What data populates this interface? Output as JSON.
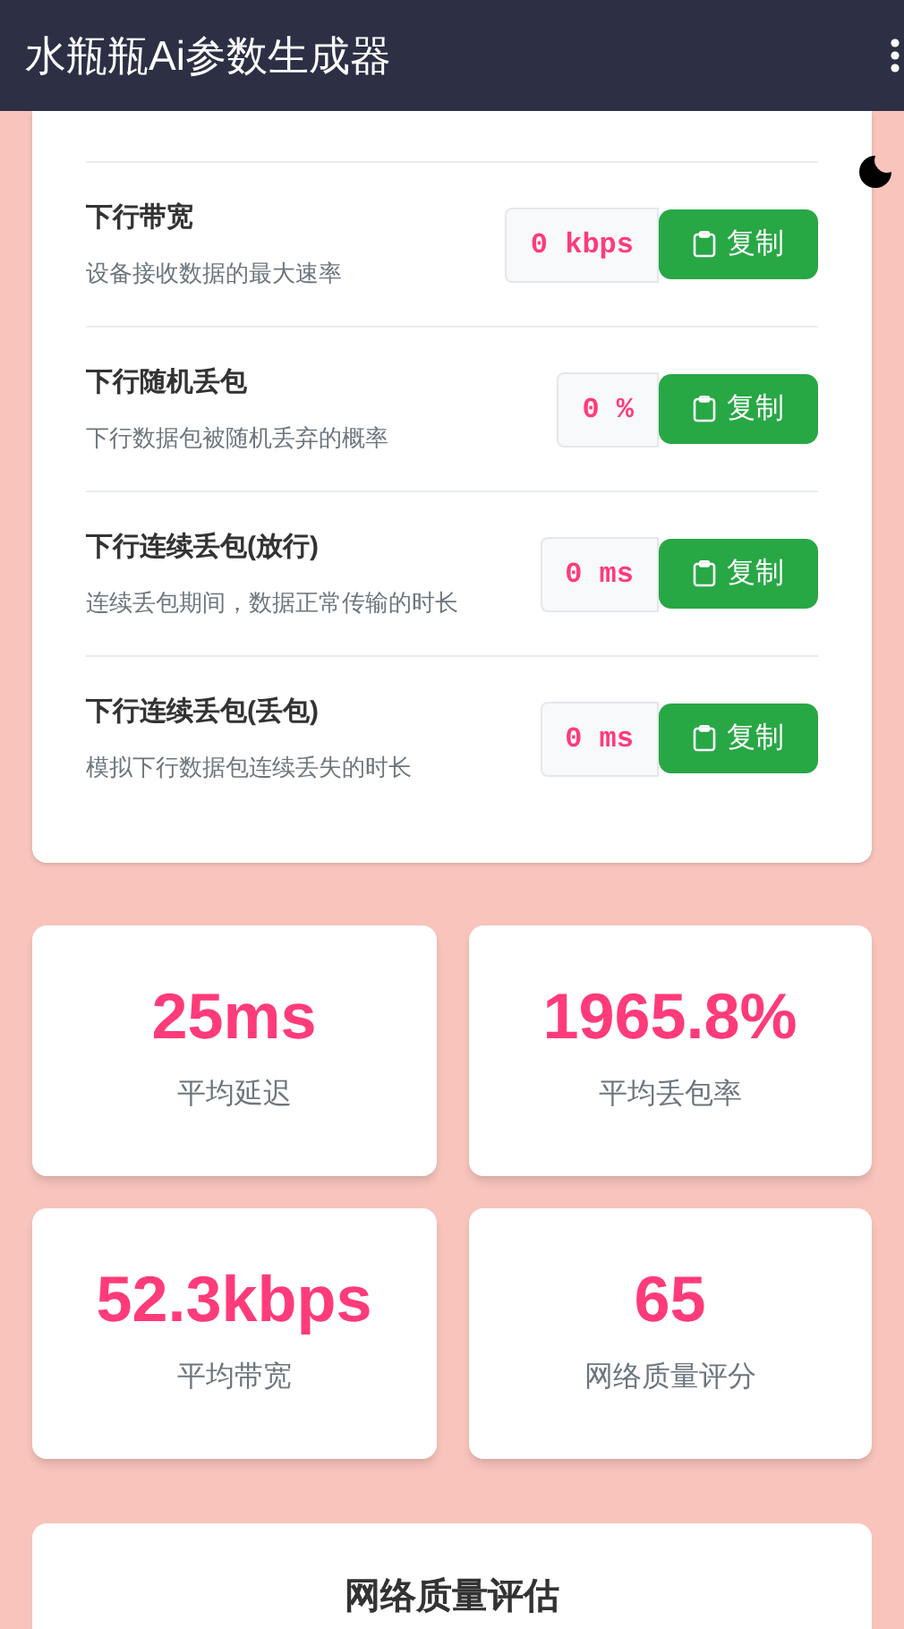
{
  "app_bar": {
    "title": "水瓶瓶Ai参数生成器"
  },
  "params": [
    {
      "title": "下行带宽",
      "description": "设备接收数据的最大速率",
      "value": "0 kbps",
      "button": "复制"
    },
    {
      "title": "下行随机丢包",
      "description": "下行数据包被随机丢弃的概率",
      "value": "0 %",
      "button": "复制"
    },
    {
      "title": "下行连续丢包(放行)",
      "description": "连续丢包期间，数据正常传输的时长",
      "value": "0 ms",
      "button": "复制"
    },
    {
      "title": "下行连续丢包(丢包)",
      "description": "模拟下行数据包连续丢失的时长",
      "value": "0 ms",
      "button": "复制"
    }
  ],
  "stats": [
    {
      "value": "25ms",
      "label": "平均延迟"
    },
    {
      "value": "1965.8%",
      "label": "平均丢包率"
    },
    {
      "value": "52.3kbps",
      "label": "平均带宽"
    },
    {
      "value": "65",
      "label": "网络质量评分"
    }
  ],
  "assessment": {
    "title": "网络质量评估"
  }
}
